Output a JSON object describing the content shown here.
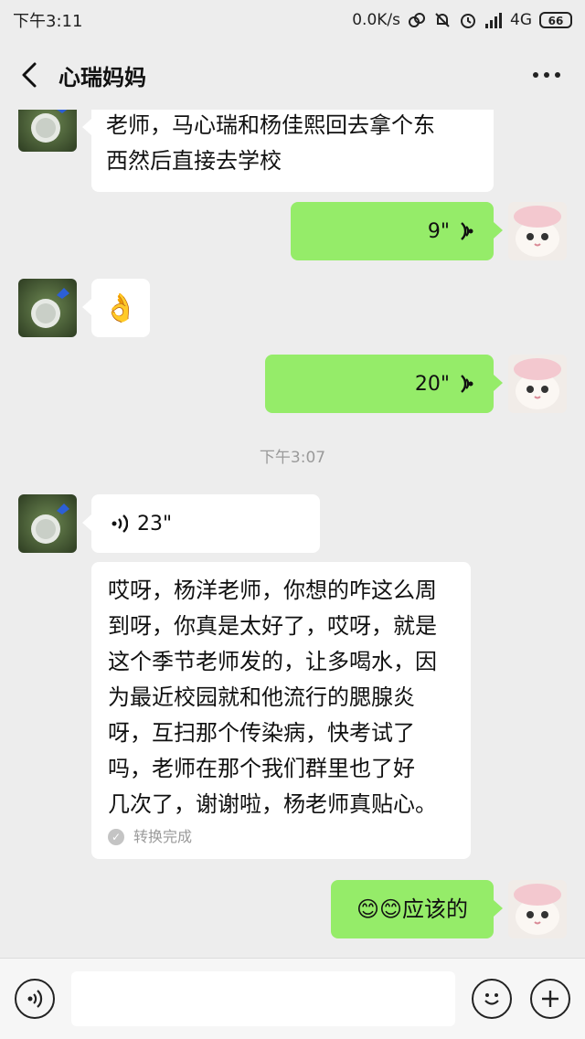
{
  "status_bar": {
    "time": "下午3:11",
    "network_speed": "0.0K/s",
    "network_type": "4G",
    "battery": "66"
  },
  "header": {
    "title": "心瑞妈妈"
  },
  "messages": [
    {
      "side": "left",
      "type": "text",
      "lines": [
        "老师，马心瑞和杨佳熙回去拿个东",
        "西然后直接去学校"
      ]
    },
    {
      "side": "right",
      "type": "voice",
      "duration": "9\""
    },
    {
      "side": "left",
      "type": "emoji",
      "content": "👌"
    },
    {
      "side": "right",
      "type": "voice",
      "duration": "20\""
    },
    {
      "type": "timestamp",
      "text": "下午3:07"
    },
    {
      "side": "left",
      "type": "voice",
      "duration": "23\""
    },
    {
      "side": "left",
      "type": "transcript",
      "lines": [
        "哎呀，杨洋老师，你想的咋这么周",
        "到呀，你真是太好了，哎呀，就是",
        "这个季节老师发的，让多喝水，因",
        "为最近校园就和他流行的腮腺炎",
        "呀，互扫那个传染病，快考试了",
        "吗，老师在那个我们群里也了好",
        "几次了，谢谢啦，杨老师真贴心。"
      ],
      "status": "转换完成"
    },
    {
      "side": "right",
      "type": "text",
      "content": "😊😊应该的"
    }
  ],
  "colors": {
    "background": "#ededed",
    "my_bubble": "#95ec69",
    "their_bubble": "#ffffff"
  },
  "icons": {
    "back": "back-arrow-icon",
    "more": "more-dots-icon",
    "voice_toggle": "voice-icon",
    "emoji": "emoji-icon",
    "plus": "plus-icon"
  }
}
